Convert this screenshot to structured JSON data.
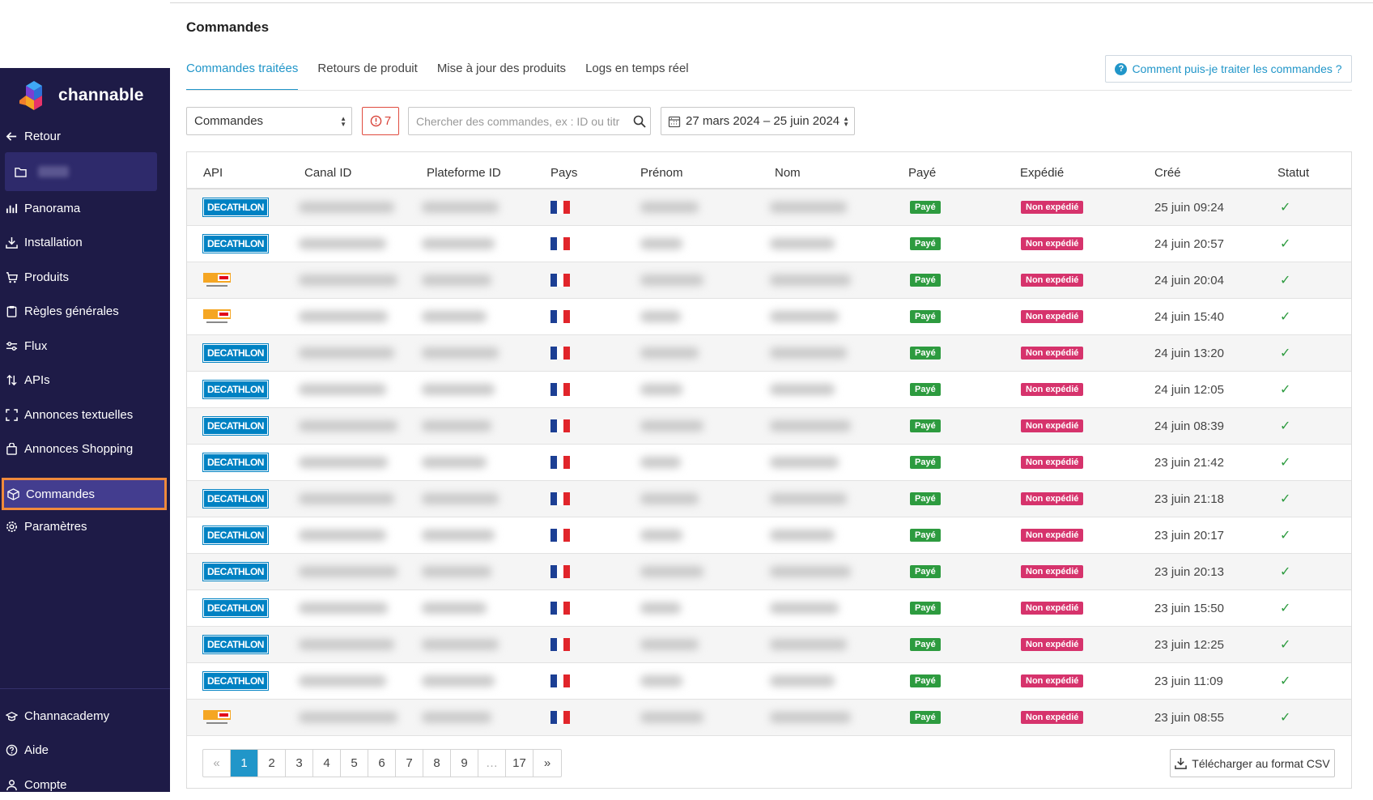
{
  "page": {
    "title": "Commandes"
  },
  "tabs": [
    {
      "label": "Commandes traitées",
      "active": true
    },
    {
      "label": "Retours de produit"
    },
    {
      "label": "Mise à jour des produits"
    },
    {
      "label": "Logs en temps réel"
    }
  ],
  "help_button": "Comment puis-je traiter les commandes ?",
  "sidebar": {
    "brand": "channable",
    "back": "Retour",
    "items": [
      {
        "label": "Panorama",
        "icon": "chart-icon"
      },
      {
        "label": "Installation",
        "icon": "download-icon"
      },
      {
        "label": "Produits",
        "icon": "cart-icon"
      },
      {
        "label": "Règles générales",
        "icon": "clipboard-icon"
      },
      {
        "label": "Flux",
        "icon": "sliders-icon"
      },
      {
        "label": "APIs",
        "icon": "arrows-updown-icon"
      },
      {
        "label": "Annonces textuelles",
        "icon": "brackets-icon"
      },
      {
        "label": "Annonces Shopping",
        "icon": "bag-icon"
      },
      {
        "label": "Commandes",
        "icon": "box-icon",
        "active": true
      },
      {
        "label": "Paramètres",
        "icon": "gear-icon"
      }
    ],
    "bottom": [
      {
        "label": "Channacademy",
        "icon": "graduation-icon"
      },
      {
        "label": "Aide",
        "icon": "question-icon"
      },
      {
        "label": "Compte",
        "icon": "user-icon"
      }
    ]
  },
  "filters": {
    "type_select": "Commandes",
    "alert_count": "7",
    "search_placeholder": "Chercher des commandes, ex : ID ou titr",
    "date_range": "27 mars 2024 – 25 juin 2024"
  },
  "table": {
    "headers": [
      "API",
      "Canal ID",
      "Plateforme ID",
      "Pays",
      "Prénom",
      "Nom",
      "Payé",
      "Expédié",
      "Créé",
      "Statut"
    ],
    "rows": [
      {
        "api": "DECATHLON",
        "paid": "Payé",
        "shipped": "Non expédié",
        "created": "25 juin 09:24"
      },
      {
        "api": "DECATHLON",
        "paid": "Payé",
        "shipped": "Non expédié",
        "created": "24 juin 20:57"
      },
      {
        "api": "fnac-darty",
        "paid": "Payé",
        "shipped": "Non expédié",
        "created": "24 juin 20:04"
      },
      {
        "api": "fnac-darty",
        "paid": "Payé",
        "shipped": "Non expédié",
        "created": "24 juin 15:40"
      },
      {
        "api": "DECATHLON",
        "paid": "Payé",
        "shipped": "Non expédié",
        "created": "24 juin 13:20"
      },
      {
        "api": "DECATHLON",
        "paid": "Payé",
        "shipped": "Non expédié",
        "created": "24 juin 12:05"
      },
      {
        "api": "DECATHLON",
        "paid": "Payé",
        "shipped": "Non expédié",
        "created": "24 juin 08:39"
      },
      {
        "api": "DECATHLON",
        "paid": "Payé",
        "shipped": "Non expédié",
        "created": "23 juin 21:42"
      },
      {
        "api": "DECATHLON",
        "paid": "Payé",
        "shipped": "Non expédié",
        "created": "23 juin 21:18"
      },
      {
        "api": "DECATHLON",
        "paid": "Payé",
        "shipped": "Non expédié",
        "created": "23 juin 20:17"
      },
      {
        "api": "DECATHLON",
        "paid": "Payé",
        "shipped": "Non expédié",
        "created": "23 juin 20:13"
      },
      {
        "api": "DECATHLON",
        "paid": "Payé",
        "shipped": "Non expédié",
        "created": "23 juin 15:50"
      },
      {
        "api": "DECATHLON",
        "paid": "Payé",
        "shipped": "Non expédié",
        "created": "23 juin 12:25"
      },
      {
        "api": "DECATHLON",
        "paid": "Payé",
        "shipped": "Non expédié",
        "created": "23 juin 11:09"
      },
      {
        "api": "fnac-darty",
        "paid": "Payé",
        "shipped": "Non expédié",
        "created": "23 juin 08:55"
      }
    ]
  },
  "pagination": {
    "prev": "«",
    "pages": [
      "1",
      "2",
      "3",
      "4",
      "5",
      "6",
      "7",
      "8",
      "9",
      "…",
      "17"
    ],
    "current": "1",
    "next": "»"
  },
  "csv_button": "Télécharger au format CSV",
  "colors": {
    "accent": "#2196c9",
    "sidebar": "#1e1b47",
    "paid": "#2d9b3f",
    "not_shipped": "#d6336c",
    "decathlon": "#0082c3"
  }
}
